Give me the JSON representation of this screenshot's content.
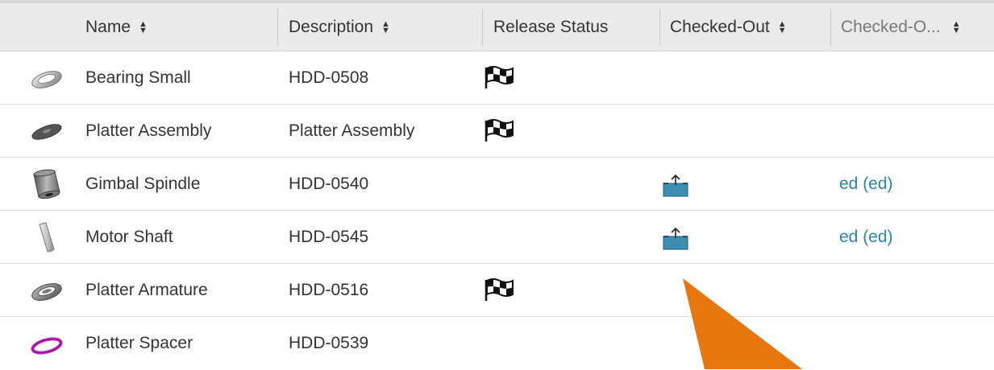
{
  "columns": [
    {
      "label": "Name"
    },
    {
      "label": "Description"
    },
    {
      "label": "Release Status"
    },
    {
      "label": "Checked-Out"
    },
    {
      "label": "Checked-O..."
    }
  ],
  "rows": [
    {
      "name": "Bearing Small",
      "description": "HDD-0508",
      "release_icon": "checkered-flag-icon",
      "checked_out_icon": "",
      "checked_out_by": "",
      "thumb": "bearing-ring"
    },
    {
      "name": "Platter Assembly",
      "description": "Platter Assembly",
      "release_icon": "checkered-flag-icon",
      "checked_out_icon": "",
      "checked_out_by": "",
      "thumb": "platter-disc"
    },
    {
      "name": "Gimbal Spindle",
      "description": "HDD-0540",
      "release_icon": "",
      "checked_out_icon": "checked-out-tray-icon",
      "checked_out_by": "ed (ed)",
      "thumb": "spindle-cylinder"
    },
    {
      "name": "Motor Shaft",
      "description": "HDD-0545",
      "release_icon": "",
      "checked_out_icon": "checked-out-tray-icon",
      "checked_out_by": "ed (ed)",
      "thumb": "shaft-rod"
    },
    {
      "name": "Platter Armature",
      "description": "HDD-0516",
      "release_icon": "checkered-flag-icon",
      "checked_out_icon": "",
      "checked_out_by": "",
      "thumb": "armature-ring"
    },
    {
      "name": "Platter Spacer",
      "description": "HDD-0539",
      "release_icon": "",
      "checked_out_icon": "",
      "checked_out_by": "",
      "thumb": "spacer-ring"
    }
  ],
  "colors": {
    "header_bg": "#ebebeb",
    "link": "#2a86a8",
    "checkout_icon": "#3d8db0",
    "annotation_arrow": "#e8760f",
    "spacer_ring": "#c724c7"
  }
}
